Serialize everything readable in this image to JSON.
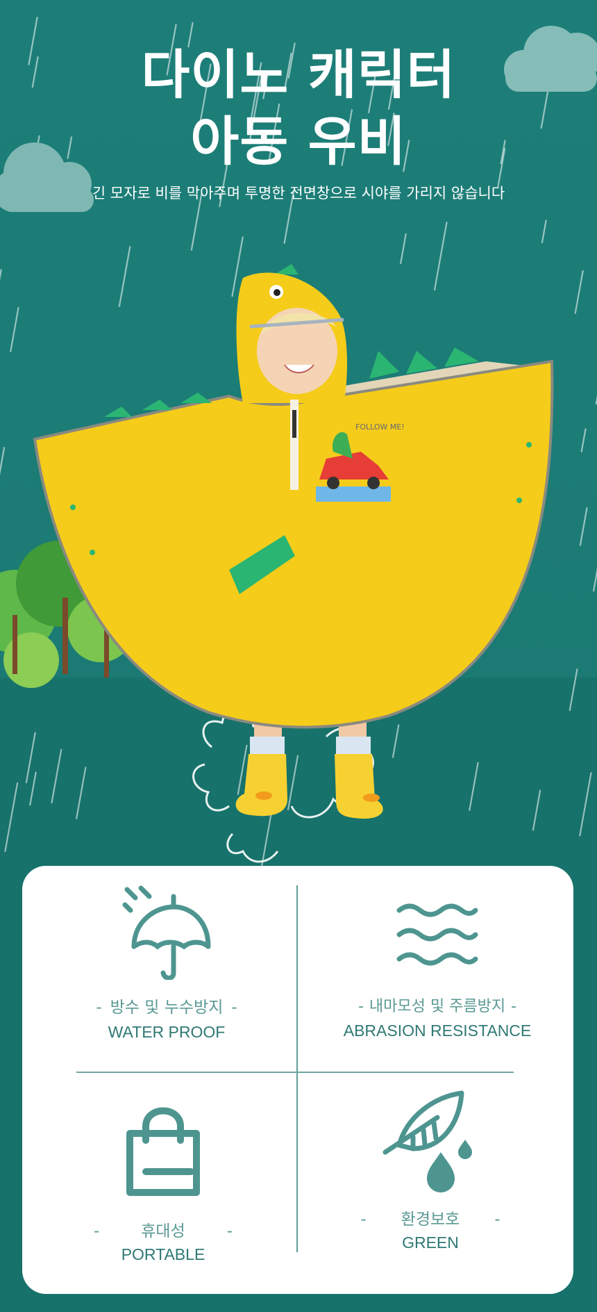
{
  "header": {
    "title_line1": "다이노 캐릭터",
    "title_line2": "아동 우비",
    "subtitle": "긴 모자로 비를 막아주며 투명한 전면창으로 시야를 가리지 않습니다"
  },
  "product_image": {
    "raincoat_print_text": "FOLLOW ME!"
  },
  "features": [
    {
      "icon": "umbrella-rain-icon",
      "label_ko": "방수 및 누수방지",
      "label_en": "WATER PROOF"
    },
    {
      "icon": "waves-icon",
      "label_ko": "내마모성 및 주름방지",
      "label_en": "ABRASION RESISTANCE"
    },
    {
      "icon": "shopping-bag-icon",
      "label_ko": "휴대성",
      "label_en": "PORTABLE"
    },
    {
      "icon": "leaf-water-drop-icon",
      "label_ko": "환경보호",
      "label_en": "GREEN"
    }
  ],
  "colors": {
    "background_teal": "#1b7b74",
    "raincoat_yellow": "#f5cc1a",
    "accent_green": "#2bb573",
    "icon_teal": "#4e9590"
  }
}
